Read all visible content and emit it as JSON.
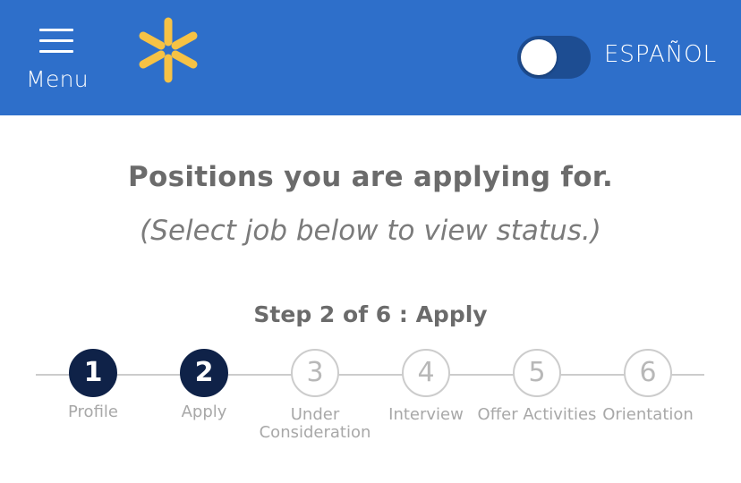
{
  "header": {
    "menu_label": "Menu",
    "language_toggle_label": "ESPAÑOL",
    "language_toggle_on": false,
    "brand_color": "#2e6fca",
    "logo_color": "#f6c245"
  },
  "main": {
    "title": "Positions you are applying for.",
    "subtitle": "(Select job below to view status.)",
    "step_status": "Step 2 of 6 : Apply"
  },
  "stepper": {
    "current_step": 2,
    "total_steps": 6,
    "steps": [
      {
        "number": "1",
        "label": "Profile",
        "completed": true
      },
      {
        "number": "2",
        "label": "Apply",
        "completed": true
      },
      {
        "number": "3",
        "label": "Under Consideration",
        "completed": false
      },
      {
        "number": "4",
        "label": "Interview",
        "completed": false
      },
      {
        "number": "5",
        "label": "Offer Activities",
        "completed": false
      },
      {
        "number": "6",
        "label": "Orientation",
        "completed": false
      }
    ]
  }
}
